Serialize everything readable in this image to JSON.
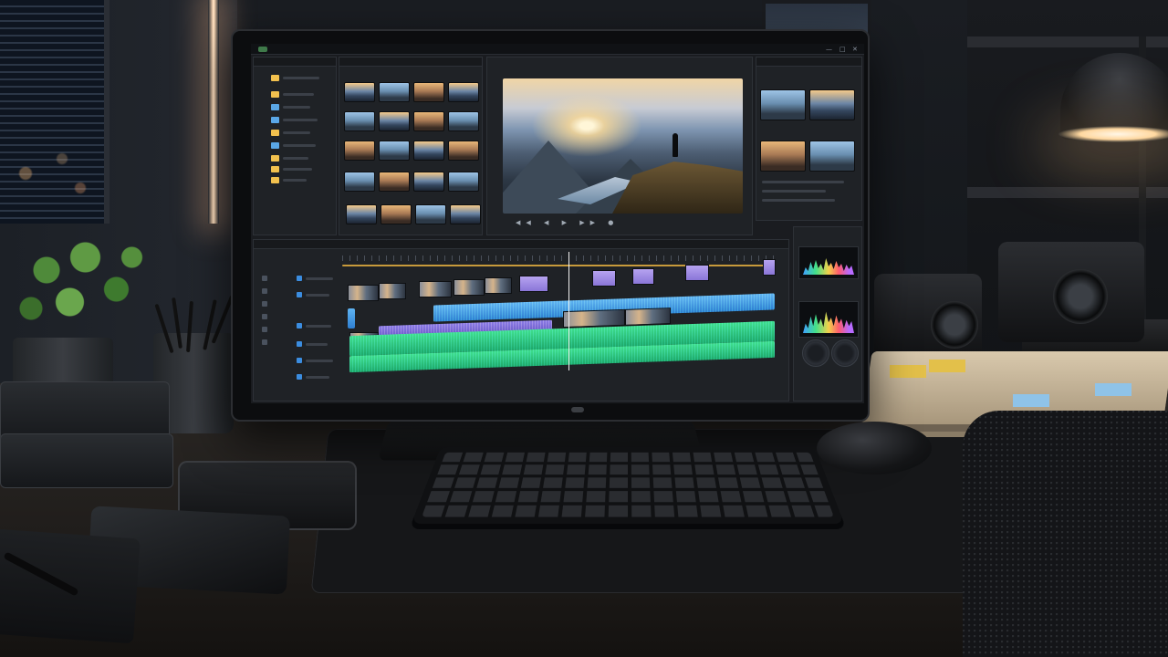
{
  "scene": {
    "description_type": "photo",
    "subject": "video-editing-workstation"
  },
  "app": {
    "window_controls": [
      "—",
      "□",
      "✕"
    ]
  },
  "colors": {
    "accent_blue": "#2e7fd1",
    "accent_green": "#1ea86a",
    "accent_purple": "#8a76d8",
    "folder_yellow": "#f2c14e",
    "lamp_warm": "#ffd8a0"
  },
  "icons": {
    "folder": "folder-icon",
    "play": "play-icon",
    "playhead": "playhead-marker"
  }
}
